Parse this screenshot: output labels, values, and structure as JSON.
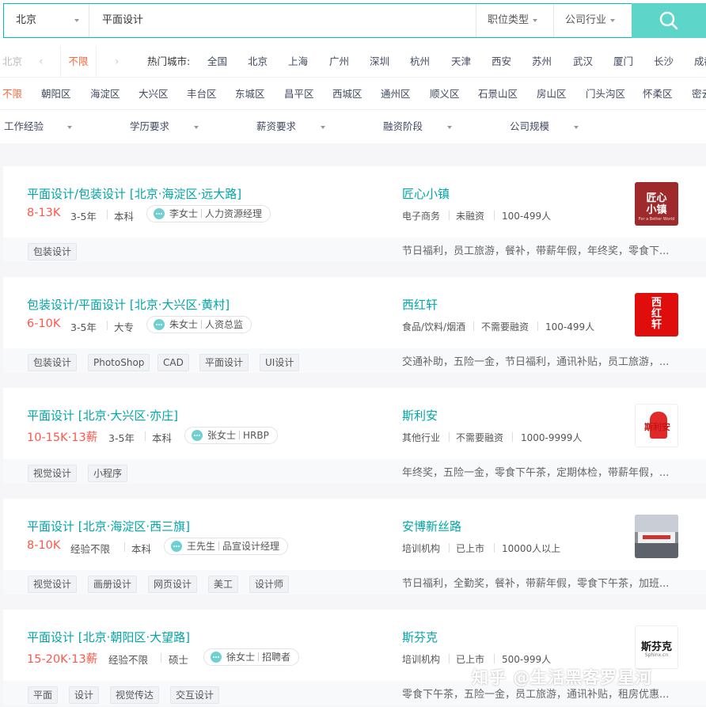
{
  "search": {
    "city": "北京",
    "query": "平面设计",
    "position_type": "职位类型",
    "industry": "公司行业"
  },
  "city_row": {
    "prev": "北京",
    "current": "不限",
    "hot_label": "热门城市:",
    "cities": [
      "全国",
      "北京",
      "上海",
      "广州",
      "深圳",
      "杭州",
      "天津",
      "西安",
      "苏州",
      "武汉",
      "厦门",
      "长沙",
      "成都"
    ]
  },
  "district_row": {
    "items": [
      "不限",
      "朝阳区",
      "海淀区",
      "大兴区",
      "丰台区",
      "东城区",
      "昌平区",
      "西城区",
      "通州区",
      "顺义区",
      "石景山区",
      "房山区",
      "门头沟区",
      "怀柔区",
      "密云"
    ]
  },
  "filters": [
    "工作经验",
    "学历要求",
    "薪资要求",
    "融资阶段",
    "公司规模"
  ],
  "jobs": [
    {
      "title": "平面设计/包装设计",
      "area": "[北京·海淀区·远大路]",
      "salary": "8-13K",
      "exp": "3-5年",
      "edu": "本科",
      "recruiter": "李女士",
      "recruiter_title": "人力资源经理",
      "company": "匠心小镇",
      "industry": "电子商务",
      "stage": "未融资",
      "size": "100-499人",
      "tags": [
        "包装设计"
      ],
      "benefits": "节日福利，员工旅游，餐补，带薪年假，年终奖，零食下...",
      "logo_text": [
        "匠心",
        "小镇",
        "For a Better World"
      ],
      "logo_bg": "#9e2a2b"
    },
    {
      "title": "包装设计/平面设计",
      "area": "[北京·大兴区·黄村]",
      "salary": "6-10K",
      "exp": "3-5年",
      "edu": "大专",
      "recruiter": "朱女士",
      "recruiter_title": "人资总监",
      "company": "西红轩",
      "industry": "食品/饮料/烟酒",
      "stage": "不需要融资",
      "size": "100-499人",
      "tags": [
        "包装设计",
        "PhotoShop",
        "CAD",
        "平面设计",
        "UI设计"
      ],
      "benefits": "交通补助，五险一金，节日福利，通讯补贴，员工旅游，...",
      "logo_text": [
        "西",
        "红",
        "轩"
      ],
      "logo_bg": "#e00d0d"
    },
    {
      "title": "平面设计",
      "area": "[北京·大兴区·亦庄]",
      "salary": "10-15K·13薪",
      "exp": "3-5年",
      "edu": "本科",
      "recruiter": "张女士",
      "recruiter_title": "HRBP",
      "company": "斯利安",
      "industry": "其他行业",
      "stage": "不需要融资",
      "size": "1000-9999人",
      "tags": [
        "视觉设计",
        "小程序"
      ],
      "benefits": "年终奖，五险一金，零食下午茶，定期体检，带薪年假，...",
      "logo_text": [
        "斯利安"
      ],
      "logo_bg": "#ffffff"
    },
    {
      "title": "平面设计",
      "area": "[北京·海淀区·西三旗]",
      "salary": "8-10K",
      "exp": "经验不限",
      "edu": "本科",
      "recruiter": "王先生",
      "recruiter_title": "品宣设计经理",
      "company": "安博新丝路",
      "industry": "培训机构",
      "stage": "已上市",
      "size": "10000人以上",
      "tags": [
        "视觉设计",
        "画册设计",
        "网页设计",
        "美工",
        "设计师"
      ],
      "benefits": "节日福利，全勤奖，餐补，带薪年假，零食下午茶，加班...",
      "logo_text": [],
      "logo_bg": "#8a8f96"
    },
    {
      "title": "平面设计",
      "area": "[北京·朝阳区·大望路]",
      "salary": "15-20K·13薪",
      "exp": "经验不限",
      "edu": "硕士",
      "recruiter": "徐女士",
      "recruiter_title": "招聘者",
      "company": "斯芬克",
      "industry": "培训机构",
      "stage": "已上市",
      "size": "500-999人",
      "tags": [
        "平面",
        "设计",
        "视觉传达",
        "交互设计"
      ],
      "benefits": "零食下午茶，五险一金，员工旅游，通讯补贴，租房优惠...",
      "logo_text": [
        "斯芬克",
        "Sphinx.cn"
      ],
      "logo_bg": "#ffffff"
    }
  ],
  "watermark": "知乎 @生活黑客罗星河"
}
